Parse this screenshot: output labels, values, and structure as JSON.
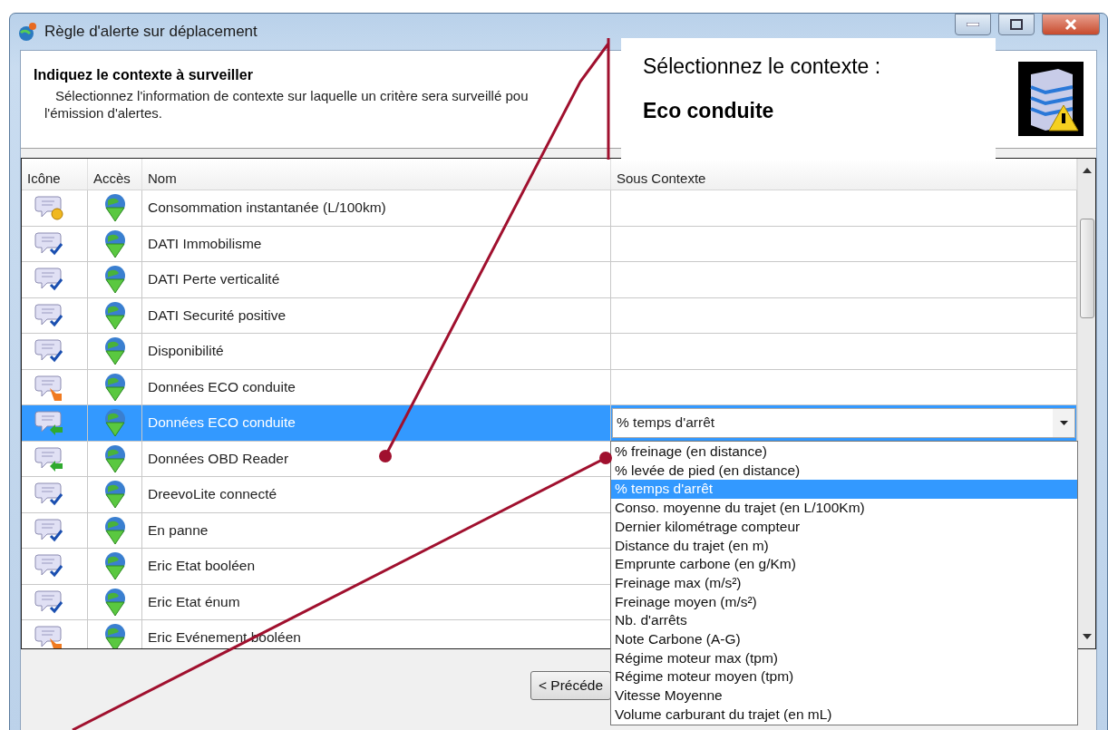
{
  "window": {
    "title": "Règle d'alerte sur déplacement"
  },
  "header": {
    "title": "Indiquez le contexte à surveiller",
    "lines": [
      "Sélectionnez l'information de contexte sur laquelle un critère sera surveillé pou",
      "l'émission d'alertes."
    ]
  },
  "table": {
    "columns": [
      "Icône",
      "Accès",
      "Nom",
      "Sous Contexte"
    ],
    "rows": [
      {
        "kind": "coin",
        "name": "Consommation instantanée (L/100km)",
        "selected": false
      },
      {
        "kind": "check",
        "name": "DATI Immobilisme",
        "selected": false
      },
      {
        "kind": "check",
        "name": "DATI Perte verticalité",
        "selected": false
      },
      {
        "kind": "check",
        "name": "DATI Securité positive",
        "selected": false
      },
      {
        "kind": "check",
        "name": "Disponibilité",
        "selected": false
      },
      {
        "kind": "hand",
        "name": "Données ECO conduite",
        "selected": false
      },
      {
        "kind": "arrow",
        "name": "Données ECO conduite",
        "selected": true,
        "sub_context": "% temps d'arrêt"
      },
      {
        "kind": "arrow",
        "name": "Données OBD Reader",
        "selected": false
      },
      {
        "kind": "check",
        "name": "DreevoLite connecté",
        "selected": false
      },
      {
        "kind": "check",
        "name": "En panne",
        "selected": false
      },
      {
        "kind": "check",
        "name": "Eric Etat booléen",
        "selected": false
      },
      {
        "kind": "check",
        "name": "Eric Etat énum",
        "selected": false
      },
      {
        "kind": "hand",
        "name": "Eric Evénement booléen",
        "selected": false
      }
    ]
  },
  "dropdown": {
    "options": [
      {
        "label": "% freinage (en distance)",
        "selected": false
      },
      {
        "label": "% levée de pied (en distance)",
        "selected": false
      },
      {
        "label": "% temps d'arrêt",
        "selected": true
      },
      {
        "label": "Conso. moyenne du trajet (en L/100Km)",
        "selected": false
      },
      {
        "label": "Dernier kilométrage compteur",
        "selected": false
      },
      {
        "label": "Distance du trajet (en m)",
        "selected": false
      },
      {
        "label": "Emprunte carbone (en g/Km)",
        "selected": false
      },
      {
        "label": "Freinage max (m/s²)",
        "selected": false
      },
      {
        "label": "Freinage moyen (m/s²)",
        "selected": false
      },
      {
        "label": "Nb. d'arrêts",
        "selected": false
      },
      {
        "label": "Note Carbone (A-G)",
        "selected": false
      },
      {
        "label": "Régime moteur max (tpm)",
        "selected": false
      },
      {
        "label": "Régime moteur moyen (tpm)",
        "selected": false
      },
      {
        "label": "Vitesse Moyenne",
        "selected": false
      },
      {
        "label": "Volume carburant du trajet (en mL)",
        "selected": false
      }
    ]
  },
  "buttons": [
    {
      "label": "< Précéde"
    }
  ],
  "callout": {
    "title": "Sélectionnez le contexte :",
    "value": "Eco conduite"
  }
}
